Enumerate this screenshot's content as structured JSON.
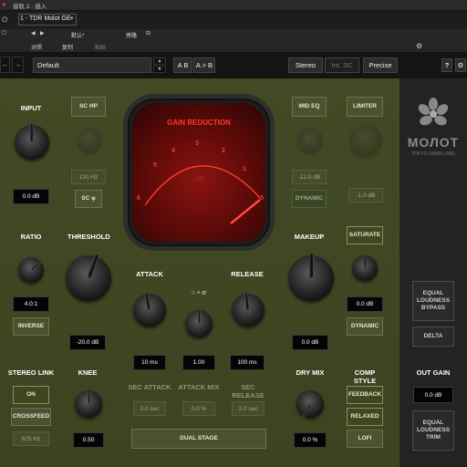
{
  "host": {
    "track_num": "音轨 2 - 插入",
    "plugin_slot": "1 - TDR Molot GE",
    "preset_default": "默认*",
    "compare_label": "对照",
    "copy_label": "复制",
    "paste_label": "粘贴",
    "bypass_label": "旁路"
  },
  "toolbar": {
    "preset_name": "Default",
    "ab_label": "A B",
    "a_to_b_label": "A > B",
    "stereo_label": "Stereo",
    "intsc_label": "Int. SC",
    "precise_label": "Precise",
    "help_label": "?"
  },
  "meter": {
    "title": "GAIN REDUCTION",
    "unit": "dB",
    "scale": [
      "6",
      "5",
      "4",
      "3",
      "2",
      "1",
      "0"
    ]
  },
  "labels": {
    "input": "INPUT",
    "ratio": "RATIO",
    "threshold": "THRESHOLD",
    "attack": "ATTACK",
    "release": "RELEASE",
    "makeup": "MAKEUP",
    "stereo_link": "STEREO LINK",
    "knee": "KNEE",
    "dry_mix": "DRY MIX",
    "comp_style": "COMP STYLE",
    "out_gain": "OUT GAIN",
    "sec_attack": "SEC ATTACK",
    "attack_mix": "ATTACK MIX",
    "sec_release": "SEC RELEASE",
    "sigma": "○ • σ"
  },
  "buttons": {
    "sc_hp": "SC HP",
    "sc_phase": "SC φ",
    "mid_eq": "MID EQ",
    "dynamic_eq": "DYNAMIC",
    "limiter": "LIMITER",
    "saturate": "SATURATE",
    "dynamic": "DYNAMIC",
    "inverse": "INVERSE",
    "on": "ON",
    "crossfeed": "CROSSFEED",
    "dual_stage": "DUAL STAGE",
    "feedback": "FEEDBACK",
    "relaxed": "RELAXED",
    "lofi": "LOFI",
    "equal_loudness_bypass": "EQUAL LOUDNESS BYPASS",
    "delta": "DELTA",
    "equal_loudness_trim": "EQUAL LOUDNESS TRIM"
  },
  "values": {
    "input": "0.0 dB",
    "sc_hp_freq": "120 Hz",
    "ratio": "4.0:1",
    "threshold": "-20.0 dB",
    "attack": "10 ms",
    "attack_mix_top": "1.00",
    "release": "100 ms",
    "mid_eq_gain": "-12.0 dB",
    "limiter": "-1.0 dB",
    "makeup": "0.0 dB",
    "saturate": "0.0 dB",
    "crossfeed_freq": "625 Hz",
    "knee": "0.50",
    "sec_attack": "2.0 sec",
    "attack_mix": "0.0 %",
    "sec_release": "2.0 sec",
    "dry_mix": "0.0 %",
    "out_gain": "0.0 dB"
  },
  "brand": {
    "name": "МОЛОТ",
    "sub": "TOKYO DAWN LABS"
  },
  "colors": {
    "panel": "#3e4622",
    "accent_red": "#ff3a2a",
    "sidebar": "#242424"
  }
}
